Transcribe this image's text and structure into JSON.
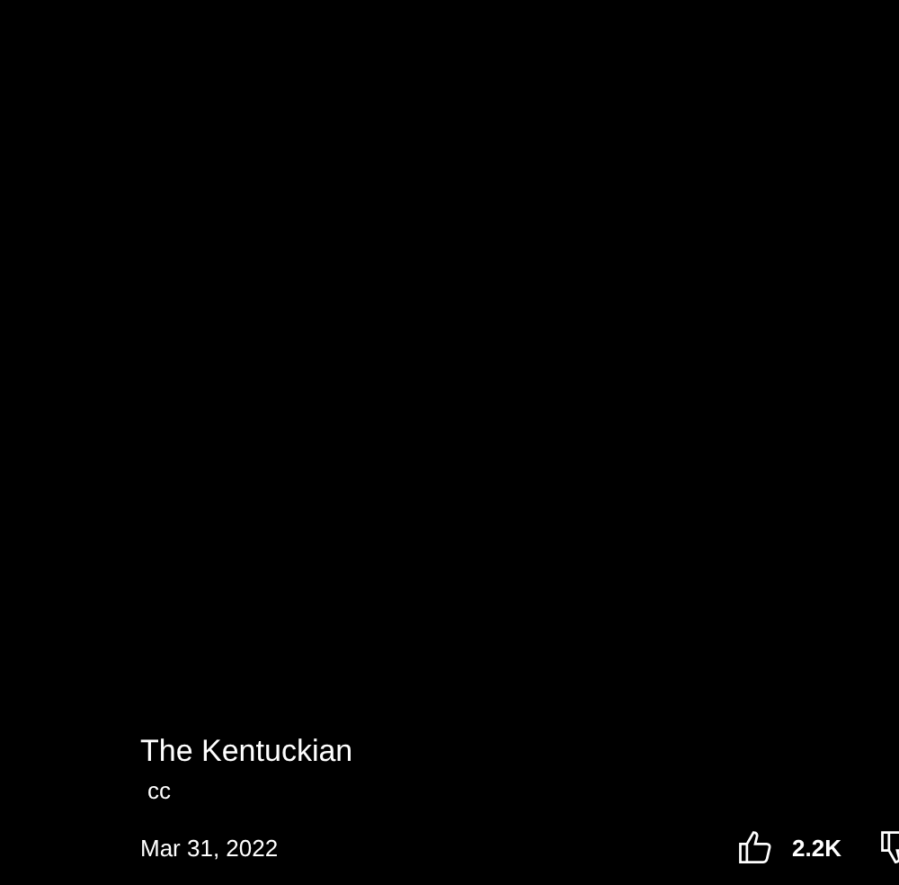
{
  "video": {
    "title": "The Kentuckian",
    "badge": "cc",
    "date": "Mar 31, 2022"
  },
  "actions": {
    "like_count": "2.2K"
  }
}
